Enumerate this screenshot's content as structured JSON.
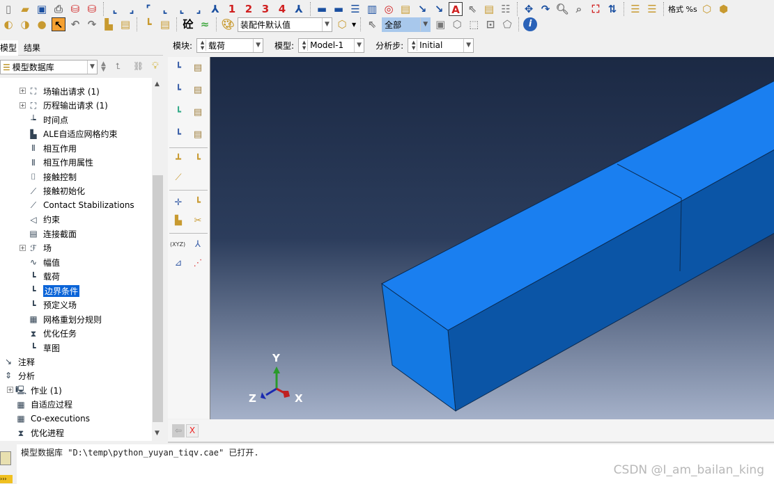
{
  "toolbar1": {
    "view_numbers": [
      "1",
      "2",
      "3",
      "4"
    ],
    "format_label": "格式 %s"
  },
  "toolbar2": {
    "render_style_combo": "装配件默认值",
    "selection_filter": "全部"
  },
  "tabs": [
    {
      "label": "模型",
      "active": true
    },
    {
      "label": "结果",
      "active": false
    }
  ],
  "context_bar": {
    "module_label": "模块:",
    "module_value": "载荷",
    "model_label": "模型:",
    "model_value": "Model-1",
    "step_label": "分析步:",
    "step_value": "Initial"
  },
  "tree": {
    "root_combo": "模型数据库",
    "items": [
      {
        "label": "场输出请求 (1)",
        "icon": "field-output-icon",
        "expandable": true
      },
      {
        "label": "历程输出请求 (1)",
        "icon": "history-output-icon",
        "expandable": true
      },
      {
        "label": "时间点",
        "icon": "time-points-icon"
      },
      {
        "label": "ALE自适应网格约束",
        "icon": "ale-constraint-icon"
      },
      {
        "label": "相互作用",
        "icon": "interaction-icon"
      },
      {
        "label": "相互作用属性",
        "icon": "interaction-property-icon"
      },
      {
        "label": "接触控制",
        "icon": "contact-control-icon"
      },
      {
        "label": "接触初始化",
        "icon": "contact-init-icon"
      },
      {
        "label": "Contact Stabilizations",
        "icon": "contact-stabilization-icon"
      },
      {
        "label": "约束",
        "icon": "constraint-icon"
      },
      {
        "label": "连接截面",
        "icon": "connector-section-icon"
      },
      {
        "label": "场",
        "icon": "field-icon",
        "expandable": true
      },
      {
        "label": "幅值",
        "icon": "amplitude-icon"
      },
      {
        "label": "载荷",
        "icon": "load-icon"
      },
      {
        "label": "边界条件",
        "icon": "boundary-condition-icon",
        "selected": true
      },
      {
        "label": "预定义场",
        "icon": "predefined-field-icon"
      },
      {
        "label": "网格重划分规则",
        "icon": "remesh-rule-icon"
      },
      {
        "label": "优化任务",
        "icon": "optimization-task-icon"
      },
      {
        "label": "草图",
        "icon": "sketch-icon"
      }
    ],
    "top_items": [
      {
        "label": "注释",
        "icon": "annotation-icon"
      },
      {
        "label": "分析",
        "icon": "analysis-icon"
      }
    ],
    "analysis_items": [
      {
        "label": "作业 (1)",
        "icon": "job-icon",
        "expandable": true
      },
      {
        "label": "自适应过程",
        "icon": "adaptivity-icon"
      },
      {
        "label": "Co-executions",
        "icon": "co-execution-icon"
      },
      {
        "label": "优化进程",
        "icon": "optimization-process-icon"
      }
    ]
  },
  "viewport": {
    "triad": {
      "x": "X",
      "y": "Y",
      "z": "Z"
    },
    "colors": {
      "bg_top": "#1b2944",
      "bg_bottom": "#a5b1c9",
      "face_light": "#1479e3",
      "face_dark": "#0b55a6",
      "face_top": "#1a7ff0"
    }
  },
  "message": "模型数据库 \"D:\\temp\\python_yuyan_tiqv.cae\" 已打开.",
  "watermark": "CSDN @I_am_bailan_king"
}
